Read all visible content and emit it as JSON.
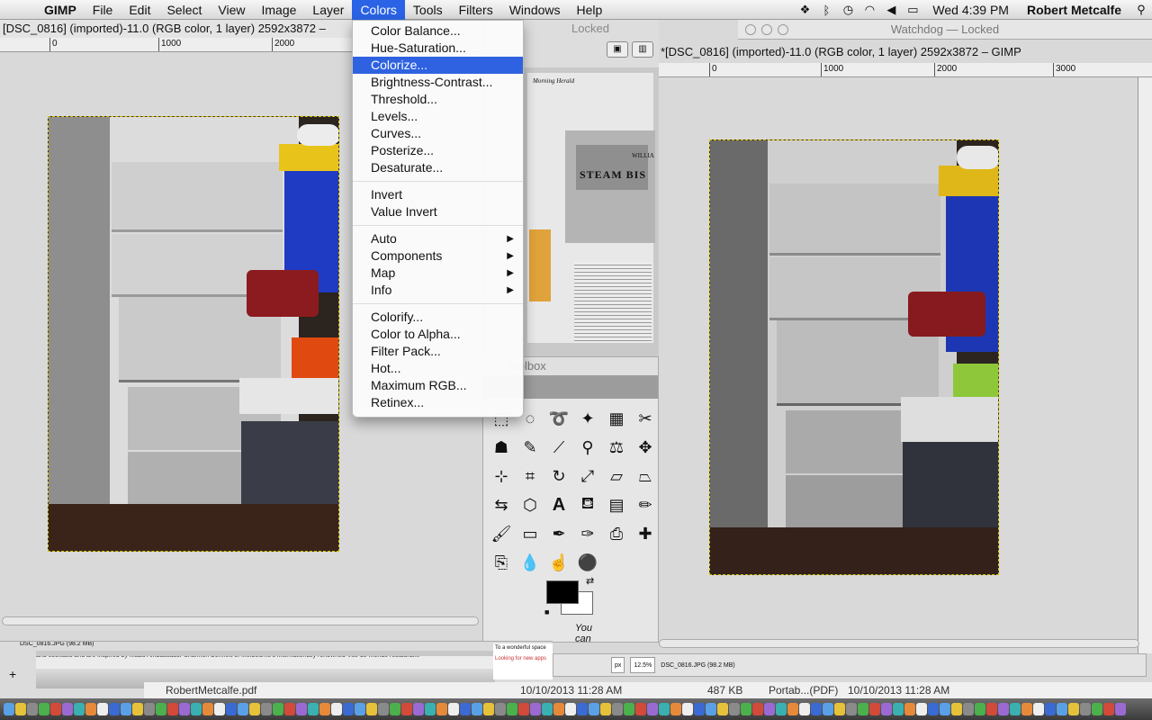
{
  "menubar": {
    "app": "GIMP",
    "items": [
      "File",
      "Edit",
      "Select",
      "View",
      "Image",
      "Layer",
      "Colors",
      "Tools",
      "Filters",
      "Windows",
      "Help"
    ],
    "clock": "Wed 4:39 PM",
    "user": "Robert Metcalfe"
  },
  "left_window": {
    "title": "[DSC_0816] (imported)-11.0 (RGB color, 1 layer) 2592x3872 –",
    "ruler_labels": [
      "0",
      "1000",
      "2000"
    ]
  },
  "mid_window": {
    "title": "Locked",
    "newspaper": {
      "masthead": "Morning Herald",
      "headline": "STEAM BIS",
      "sign": "WILLIA"
    }
  },
  "colors_menu": {
    "groups": [
      [
        "Color Balance...",
        "Hue-Saturation...",
        "Colorize...",
        "Brightness-Contrast...",
        "Threshold...",
        "Levels...",
        "Curves...",
        "Posterize...",
        "Desaturate..."
      ],
      [
        "Invert",
        "Value Invert"
      ],
      [
        "Auto",
        "Components",
        "Map",
        "Info"
      ],
      [
        "Colorify...",
        "Color to Alpha...",
        "Filter Pack...",
        "Hot...",
        "Maximum RGB...",
        "Retinex..."
      ]
    ],
    "highlighted": "Colorize..."
  },
  "toolbox": {
    "title": "Toolbox",
    "hint": [
      "You",
      "can"
    ]
  },
  "right_window": {
    "title": "Watchdog — Locked",
    "doc_title": "*[DSC_0816] (imported)-11.0 (RGB color, 1 layer) 2592x3872 – GIMP",
    "ruler_labels": [
      "0",
      "1000",
      "2000",
      "3000"
    ],
    "status": {
      "unit": "px",
      "zoom": "12.5%",
      "file": "DSC_0816.JPG (98.2 MB)"
    }
  },
  "left_status": {
    "file": "DSC_0816.JPG (98.2 MB)",
    "snippet": "and cocktails and are inspired by Maau Ambassador Shannon Bennett of Melbourne's internationally renowned Vue de monde restaurant.",
    "snippet2": "Looking for new apps",
    "snippet3": "To a wonderful space"
  },
  "finder_row": {
    "name": "RobertMetcalfe.pdf",
    "date": "10/10/2013 11:28 AM",
    "size": "487 KB",
    "kind": "Portab...(PDF)",
    "date2": "10/10/2013 11:28 AM"
  }
}
